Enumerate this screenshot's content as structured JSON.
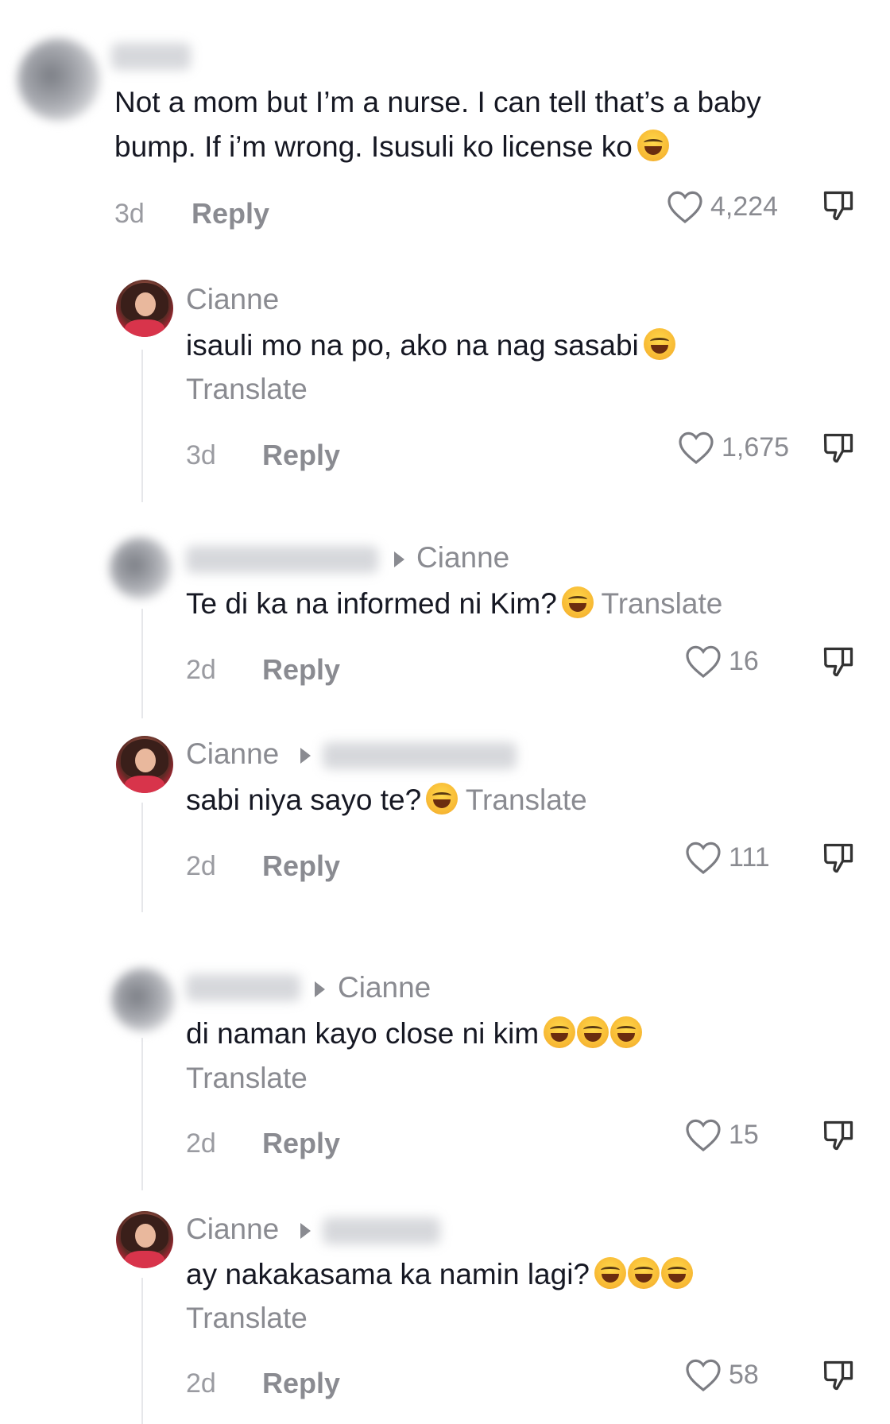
{
  "comments": [
    {
      "text1": "Not a mom but I’m a nurse. I can tell that’s a baby",
      "text2": "bump. If i’m wrong. Isusuli ko license ko",
      "emoji": "tears-of-joy",
      "time": "3d",
      "reply": "Reply",
      "likes": "4,224"
    },
    {
      "username": "Cianne",
      "text": "isauli mo na po, ako na nag sasabi",
      "emoji": "tears-of-joy",
      "translate": "Translate",
      "time": "3d",
      "reply": "Reply",
      "likes": "1,675"
    },
    {
      "reply_to": "Cianne",
      "text": "Te di ka na informed ni Kim?",
      "emoji": "tears-of-joy",
      "translate": "Translate",
      "time": "2d",
      "reply": "Reply",
      "likes": "16"
    },
    {
      "username": "Cianne",
      "text": "sabi niya sayo te?",
      "emoji": "tears-of-joy",
      "translate": "Translate",
      "time": "2d",
      "reply": "Reply",
      "likes": "111"
    },
    {
      "reply_to": "Cianne",
      "text": "di naman kayo close ni kim",
      "emoji": "tears-of-joy x3",
      "translate": "Translate",
      "time": "2d",
      "reply": "Reply",
      "likes": "15"
    },
    {
      "username": "Cianne",
      "text": "ay nakakasama ka namin lagi?",
      "emoji": "grinning-sweat x3",
      "translate": "Translate",
      "time": "2d",
      "reply": "Reply",
      "likes": "58"
    }
  ],
  "icons": {
    "like": "heart-outline-icon",
    "dislike": "thumbs-down-icon",
    "reply_arrow": "caret-right-icon"
  }
}
